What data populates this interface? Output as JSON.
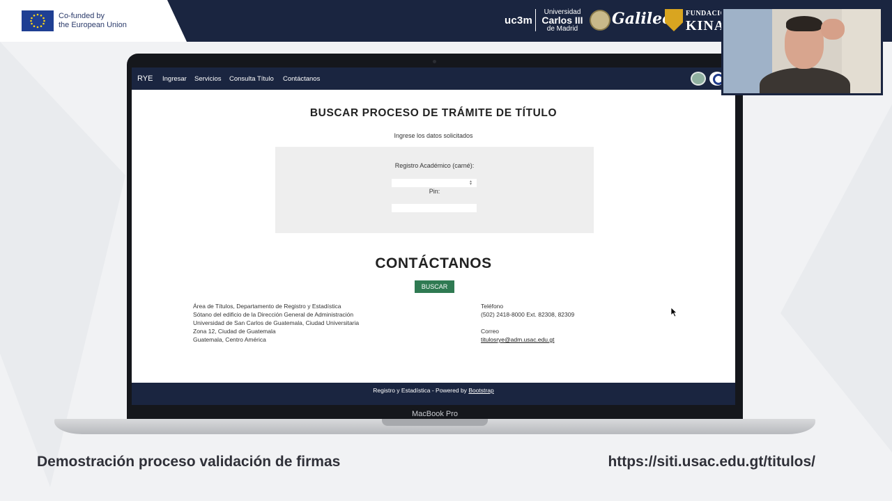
{
  "banner": {
    "eu_line1": "Co-funded by",
    "eu_line2": "the European Union",
    "uc3m": "uc3m",
    "uc3m_line1": "Universidad",
    "uc3m_line2": "Carlos III",
    "uc3m_line3": "de Madrid",
    "galileo": "Galileo",
    "kinal_line1": "FUNDACIÓN",
    "kinal_line2": "KINAL"
  },
  "laptop": {
    "label": "MacBook Pro"
  },
  "site": {
    "brand": "RYE",
    "nav": [
      "Ingresar",
      "Servicios",
      "Consulta Título",
      "Contáctanos"
    ],
    "title": "BUSCAR PROCESO DE TRÁMITE DE TÍTULO",
    "subtitle": "Ingrese los datos solicitados",
    "form": {
      "registro_label": "Registro Académico (carné):",
      "registro_value": "",
      "pin_label": "Pin:",
      "pin_value": "",
      "submit": "BUSCAR"
    },
    "contact_title": "CONTÁCTANOS",
    "address": [
      "Área de Títulos, Departamento de Registro y Estadística",
      "Sótano del edificio de la Dirección General de Administración",
      "Universidad de San Carlos de Guatemala, Ciudad Universitaria",
      "Zona 12, Ciudad de Guatemala",
      "Guatemala, Centro América"
    ],
    "phone_label": "Teléfono",
    "phone": "(502) 2418-8000 Ext. 82308, 82309",
    "email_label": "Correo",
    "email": "titulosrye@adm.usac.edu.gt",
    "footer_text": "Registro y Estadística - Powered by ",
    "footer_link": "Bootstrap"
  },
  "caption": {
    "left": "Demostración proceso validación de firmas",
    "right": "https://siti.usac.edu.gt/titulos/"
  },
  "colors": {
    "navy": "#1a2540",
    "button_green": "#2f7a52",
    "form_bg": "#eeeeee"
  }
}
